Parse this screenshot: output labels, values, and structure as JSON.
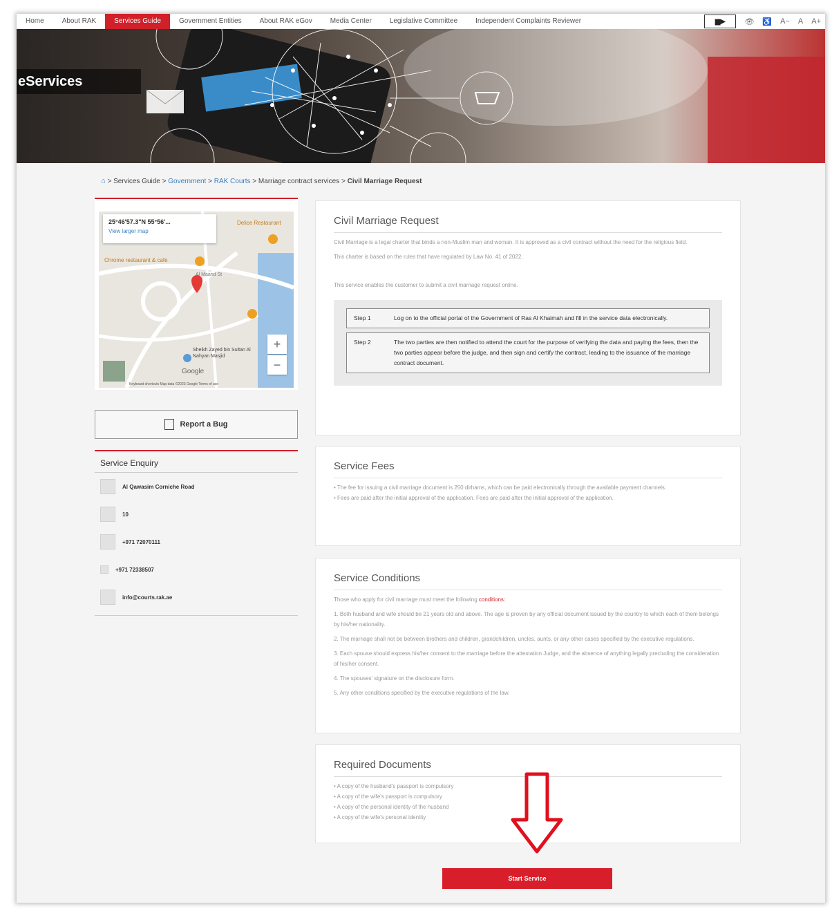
{
  "nav": {
    "items": [
      "Home",
      "About RAK",
      "Services Guide",
      "Government Entities",
      "About RAK eGov",
      "Media Center",
      "Legislative Committee",
      "Independent Complaints Reviewer"
    ],
    "active_index": 2,
    "tools": {
      "monitor": "▆▶",
      "eye": "👁",
      "person": "♿",
      "font_minus": "A−",
      "font_normal": "A",
      "font_plus": "A+"
    }
  },
  "hero": {
    "title": "eServices"
  },
  "breadcrumb": {
    "home_icon": "home-icon",
    "items": [
      "Services Guide",
      "Government",
      "RAK Courts",
      "Marriage contract services",
      "Civil Marriage Request"
    ],
    "separator": ">"
  },
  "map": {
    "coords": "25°46'57.3\"N 55°56'...",
    "larger_map": "View larger map",
    "labels": {
      "restaurant": "Delice Restaurant",
      "cafe": "Chrome restaurant & cafe",
      "street1": "Al Maarid St",
      "mosque": "Sheikh Zayed bin Sultan Al Nahyan Masjid",
      "logo": "Google",
      "footer": "Keyboard shortcuts   Map data ©2023 Google   Terms of use"
    },
    "zoom_in": "+",
    "zoom_out": "−"
  },
  "report_bug": {
    "label": "Report a Bug"
  },
  "enquiry": {
    "title": "Service Enquiry",
    "rows": [
      {
        "icon": "location-icon",
        "text": "Al Qawasim Corniche Road"
      },
      {
        "icon": "mailbox-icon",
        "text": "10"
      },
      {
        "icon": "phone-icon",
        "text": "+971 72070111"
      },
      {
        "icon": "fax-icon",
        "text": "+971 72338507"
      },
      {
        "icon": "email-icon",
        "text": "info@courts.rak.ae"
      }
    ]
  },
  "request": {
    "title": "Civil Marriage Request",
    "paragraphs": [
      "Civil Marriage is a legal charter that binds a non-Muslim man and woman. It is approved as a civil contract without the need for the religious field.",
      "This charter is based on the rules that have regulated by Law No. 41 of 2022.",
      "This service enables the customer to submit a civil marriage request online."
    ],
    "steps": [
      {
        "label": "Step 1",
        "text": "Log on to the official portal of the Government of Ras Al Khaimah and fill in the service data electronically."
      },
      {
        "label": "Step 2",
        "text": "The two parties are then notified to attend the court for the purpose of verifying the data and paying the fees, then the two parties appear before the judge, and then sign and certify the contract, leading to the issuance of the marriage contract document."
      }
    ]
  },
  "fees": {
    "title": "Service Fees",
    "items": [
      "• The fee for issuing a civil marriage document is 250 dirhams, which can be paid electronically through the available payment channels.",
      "• Fees are paid after the initial approval of the application. Fees are paid after the initial approval of the application."
    ]
  },
  "conditions": {
    "title": "Service Conditions",
    "intro": "Those who apply for civil marriage must meet the following",
    "intro_link": "conditions:",
    "items": [
      "1. Both husband and wife should be 21 years old and above. The age is proven by any official document issued by the country to which each of them belongs by his/her nationality.",
      "2. The marriage shall not be between brothers and children, grandchildren, uncles, aunts, or any other cases specified by the executive regulations.",
      "3. Each spouse should express his/her consent to the marriage before the attestation Judge, and the absence of anything legally precluding the consideration of his/her consent.",
      "4. The spouses' signature on the disclosure form.",
      "5. Any other conditions specified by the executive regulations of the law."
    ]
  },
  "documents": {
    "title": "Required Documents",
    "items": [
      "• A copy of the husband's passport is compulsory",
      "• A copy of the wife's passport is compulsory",
      "• A copy of the personal identity of the husband",
      "• A copy of the wife's personal identity"
    ]
  },
  "start_button": {
    "label": "Start Service"
  },
  "colors": {
    "accent": "#d0202a",
    "link": "#3a7fc1"
  }
}
